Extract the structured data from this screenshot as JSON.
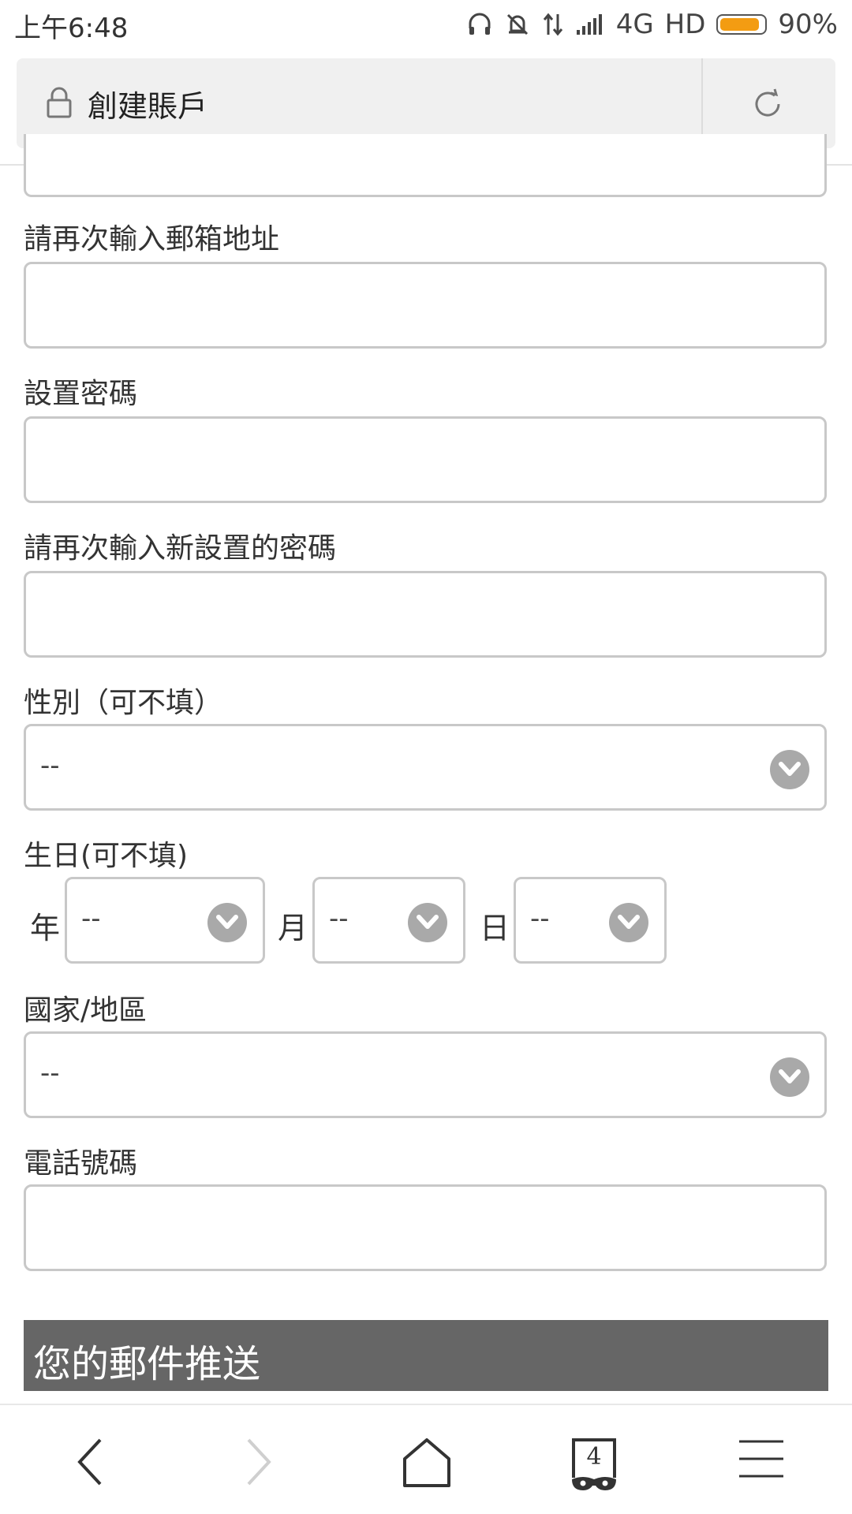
{
  "status_bar": {
    "time": "上午6:48",
    "network": "4G",
    "hd": "HD",
    "battery_percent": "90%",
    "battery_level": 0.9,
    "battery_color": "#f39c12"
  },
  "url_bar": {
    "title": "創建賬戶",
    "lock_icon": "lock-icon",
    "reload_icon": "reload-icon"
  },
  "form": {
    "confirm_email_label": "請再次輸入郵箱地址",
    "password_label": "設置密碼",
    "confirm_password_label": "請再次輸入新設置的密碼",
    "gender_label": "性別（可不填）",
    "gender_value": "--",
    "birthday_label": "生日(可不填)",
    "year_label": "年",
    "year_value": "--",
    "month_label": "月",
    "month_value": "--",
    "day_label": "日",
    "day_value": "--",
    "country_label": "國家/地區",
    "country_value": "--",
    "phone_label": "電話號碼"
  },
  "section": {
    "mail_push_header": "您的郵件推送",
    "header_color": "#666666"
  },
  "bottom_nav": {
    "tab_count": "4",
    "icons": [
      "back-icon",
      "forward-icon",
      "home-icon",
      "tabs-icon",
      "menu-icon"
    ]
  }
}
